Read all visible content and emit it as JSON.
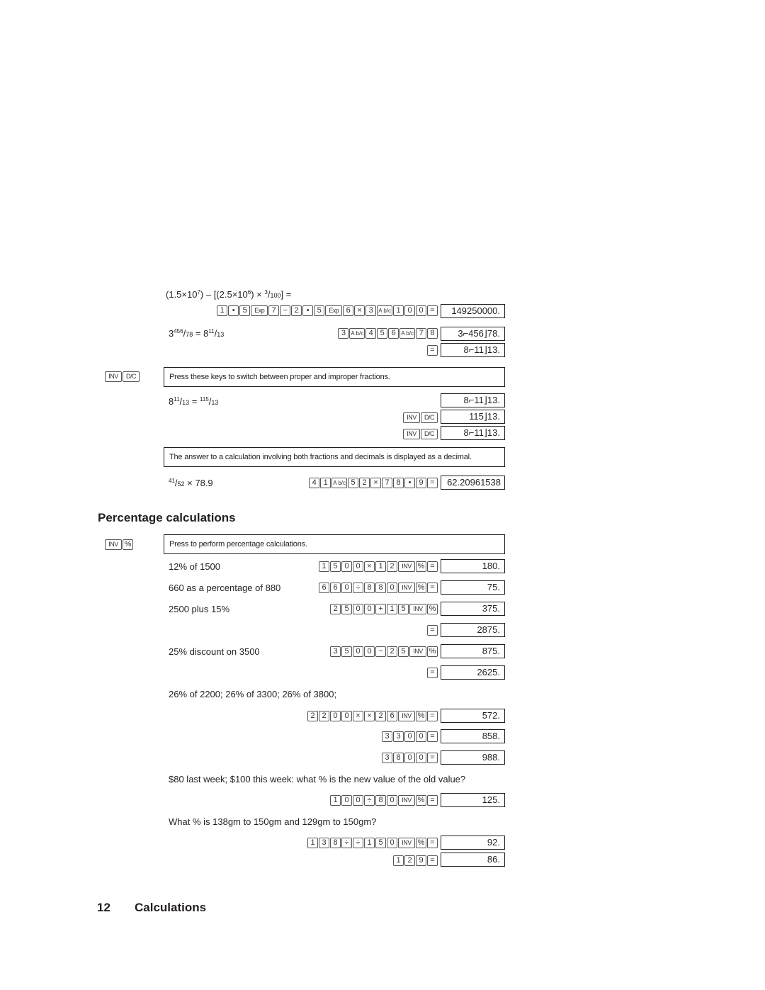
{
  "fraction_section": {
    "example1": {
      "expression_parts": [
        "(1.5×10",
        "7",
        ") – [(2.5×10",
        "6",
        ") × ",
        "3",
        "/",
        "100",
        "] ="
      ],
      "keys": [
        "1",
        "•",
        "5",
        "Exp",
        "7",
        "−",
        "2",
        "•",
        "5",
        "Exp",
        "6",
        "×",
        "3",
        "A b/c",
        "1",
        "0",
        "0",
        "="
      ],
      "result": "149250000."
    },
    "example2": {
      "expression_parts": [
        "3",
        "456",
        "/",
        "78",
        " = 8",
        "11",
        "/",
        "13"
      ],
      "keys": [
        "3",
        "A b/c",
        "4",
        "5",
        "6",
        "A b/c",
        "7",
        "8"
      ],
      "result": "3⌐456⌋78.",
      "keys2": [
        "="
      ],
      "result2": "8⌐11⌋13."
    },
    "inv_dc_keys": [
      "INV",
      "D/C"
    ],
    "inv_dc_note": "Press these keys to switch between proper and improper fractions.",
    "example3": {
      "expression_parts": [
        "8",
        "11",
        "/",
        "13",
        " = ",
        "115",
        "/",
        "13"
      ],
      "result": "8⌐11⌋13.",
      "step2_keys": [
        "INV",
        "D/C"
      ],
      "step2_result": "115⌋13.",
      "step3_keys": [
        "INV",
        "D/C"
      ],
      "step3_result": "8⌐11⌋13."
    },
    "decimal_note": "The answer to a calculation involving both fractions and decimals is displayed as a decimal.",
    "example4": {
      "expression_parts": [
        "41",
        "/",
        "52",
        " × 78.9"
      ],
      "keys": [
        "4",
        "1",
        "A b/c",
        "5",
        "2",
        "×",
        "7",
        "8",
        "•",
        "9",
        "="
      ],
      "result": "62.20961538"
    }
  },
  "percentage_section": {
    "heading": "Percentage calculations",
    "inv_pct_keys": [
      "INV",
      "%"
    ],
    "note": "Press to perform percentage calculations.",
    "rows": [
      {
        "label": "12% of 1500",
        "keys": [
          "1",
          "5",
          "0",
          "0",
          "×",
          "1",
          "2",
          "INV",
          "%",
          "="
        ],
        "result": "180."
      },
      {
        "label": "660 as a percentage of 880",
        "keys": [
          "6",
          "6",
          "0",
          "÷",
          "8",
          "8",
          "0",
          "INV",
          "%",
          "="
        ],
        "result": "75."
      },
      {
        "label": "2500 plus 15%",
        "keys": [
          "2",
          "5",
          "0",
          "0",
          "+",
          "1",
          "5",
          "INV",
          "%"
        ],
        "result": "375."
      },
      {
        "label": "",
        "keys": [
          "="
        ],
        "result": "2875."
      },
      {
        "label": "25% discount on 3500",
        "keys": [
          "3",
          "5",
          "0",
          "0",
          "−",
          "2",
          "5",
          "INV",
          "%"
        ],
        "result": "875."
      },
      {
        "label": "",
        "keys": [
          "="
        ],
        "result": "2625."
      }
    ],
    "constant_label": "26% of 2200; 26% of 3300; 26% of 3800;",
    "constant_rows": [
      {
        "keys": [
          "2",
          "2",
          "0",
          "0",
          "×",
          "×",
          "2",
          "6",
          "INV",
          "%",
          "="
        ],
        "result": "572."
      },
      {
        "keys": [
          "3",
          "3",
          "0",
          "0",
          "="
        ],
        "result": "858."
      },
      {
        "keys": [
          "3",
          "8",
          "0",
          "0",
          "="
        ],
        "result": "988."
      }
    ],
    "week_label": "$80 last week; $100 this week: what % is the new value of the old value?",
    "week_row": {
      "keys": [
        "1",
        "0",
        "0",
        "÷",
        "8",
        "0",
        "INV",
        "%",
        "="
      ],
      "result": "125."
    },
    "gm_label": "What % is 138gm to 150gm and 129gm to 150gm?",
    "gm_rows": [
      {
        "keys": [
          "1",
          "3",
          "8",
          "÷",
          "÷",
          "1",
          "5",
          "0",
          "INV",
          "%",
          "="
        ],
        "result": "92."
      },
      {
        "keys": [
          "1",
          "2",
          "9",
          "="
        ],
        "result": "86."
      }
    ]
  },
  "footer": {
    "page_number": "12",
    "section_title": "Calculations"
  }
}
